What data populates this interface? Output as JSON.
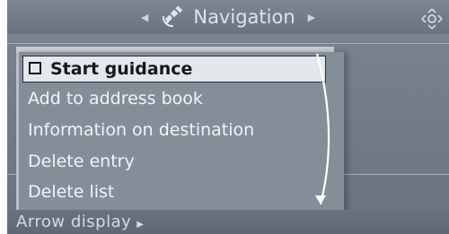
{
  "header": {
    "title": "Navigation",
    "left_arrow_icon": "triangle-left",
    "right_arrow_icon": "triangle-right",
    "app_icon": "satellite-icon",
    "corner_icon": "controller-icon"
  },
  "menu": {
    "items": [
      {
        "label": "Start guidance",
        "selected": true
      },
      {
        "label": "Add to address book",
        "selected": false
      },
      {
        "label": "Information on destination",
        "selected": false
      },
      {
        "label": "Delete entry",
        "selected": false
      },
      {
        "label": "Delete list",
        "selected": false
      }
    ]
  },
  "footer": {
    "label": "Arrow display",
    "arrow_icon": "triangle-right"
  },
  "colors": {
    "background": "#6f7784",
    "highlight": "#e4e7eb",
    "text": "#f2f4f7"
  }
}
